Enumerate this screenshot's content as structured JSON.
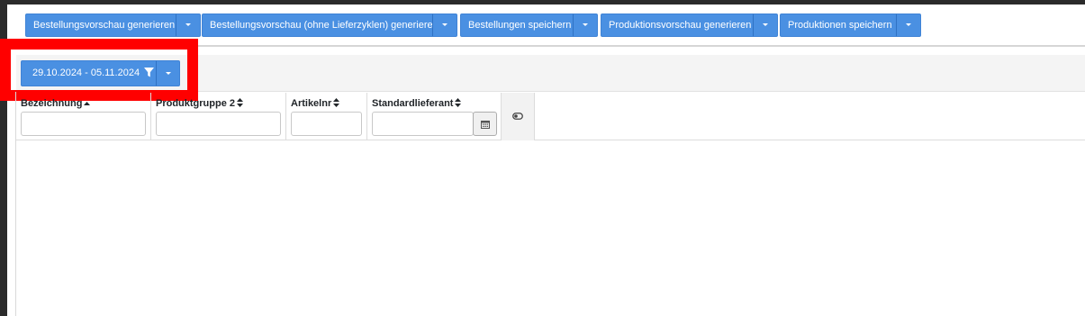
{
  "toolbar": {
    "buttons": [
      {
        "label": "Bestellungsvorschau generieren"
      },
      {
        "label": "Bestellungsvorschau (ohne Lieferzyklen) generieren"
      },
      {
        "label": "Bestellungen speichern"
      },
      {
        "label": "Produktionsvorschau generieren"
      },
      {
        "label": "Produktionen speichern"
      }
    ]
  },
  "filter": {
    "date_range": "29.10.2024 - 05.11.2024",
    "icon": "filter-icon"
  },
  "grid": {
    "columns": [
      {
        "header": "Bezeichnung",
        "sort": "ascending"
      },
      {
        "header": "Produktgruppe 2",
        "sort": "none"
      },
      {
        "header": "Artikelnr",
        "sort": "none"
      },
      {
        "header": "Standardlieferant",
        "sort": "none"
      }
    ]
  },
  "colors": {
    "primary_button": "#4a90e2",
    "highlight": "#ff0000",
    "header_bg": "#f4f4f4"
  }
}
